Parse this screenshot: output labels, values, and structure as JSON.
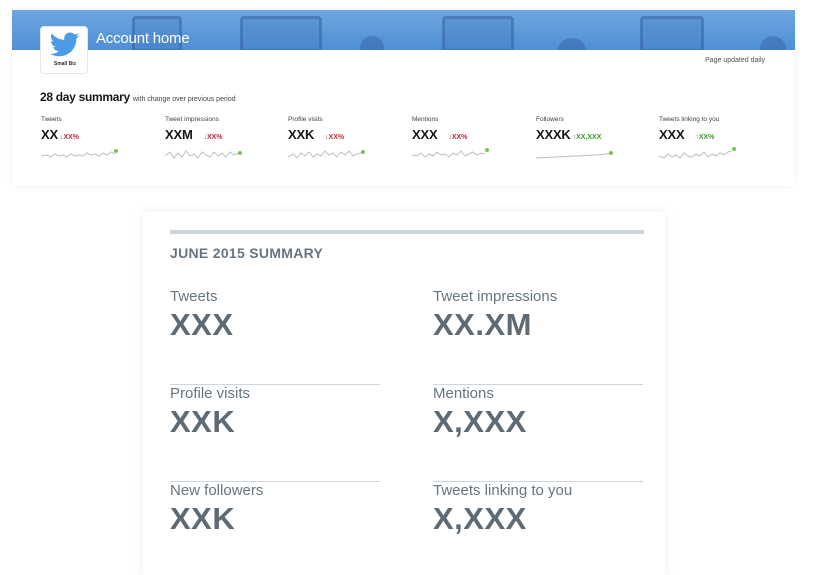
{
  "header": {
    "title": "Account home",
    "logo_caption": "Small Biz",
    "page_updated": "Page updated daily"
  },
  "summary28": {
    "title": "28 day summary",
    "subtitle": "with change over previous period",
    "metrics": [
      {
        "label": "Tweets",
        "value": "XX",
        "change": "↓XX%",
        "direction": "down"
      },
      {
        "label": "Tweet impressions",
        "value": "XXM",
        "change": "↓XX%",
        "direction": "down"
      },
      {
        "label": "Profile visits",
        "value": "XXK",
        "change": "↓XX%",
        "direction": "down"
      },
      {
        "label": "Mentions",
        "value": "XXX",
        "change": "↓XX%",
        "direction": "down"
      },
      {
        "label": "Followers",
        "value": "XXXK",
        "change": "↑XX,XXX",
        "direction": "up"
      },
      {
        "label": "Tweets linking to you",
        "value": "XXX",
        "change": "↑XX%",
        "direction": "up"
      }
    ]
  },
  "month_summary": {
    "title": "JUNE 2015 SUMMARY",
    "items": [
      {
        "label": "Tweets",
        "value": "XXX"
      },
      {
        "label": "Tweet impressions",
        "value": "XX.XM"
      },
      {
        "label": "Profile visits",
        "value": "XXK"
      },
      {
        "label": "Mentions",
        "value": "X,XXX"
      },
      {
        "label": "New followers",
        "value": "XXK"
      },
      {
        "label": "Tweets linking to you",
        "value": "X,XXX"
      }
    ]
  },
  "colors": {
    "banner": "#4f8fd6",
    "down": "#c8283c",
    "up": "#3d9c2a",
    "spark_line": "#b8c0c6",
    "spark_dot": "#7cbf4a"
  }
}
